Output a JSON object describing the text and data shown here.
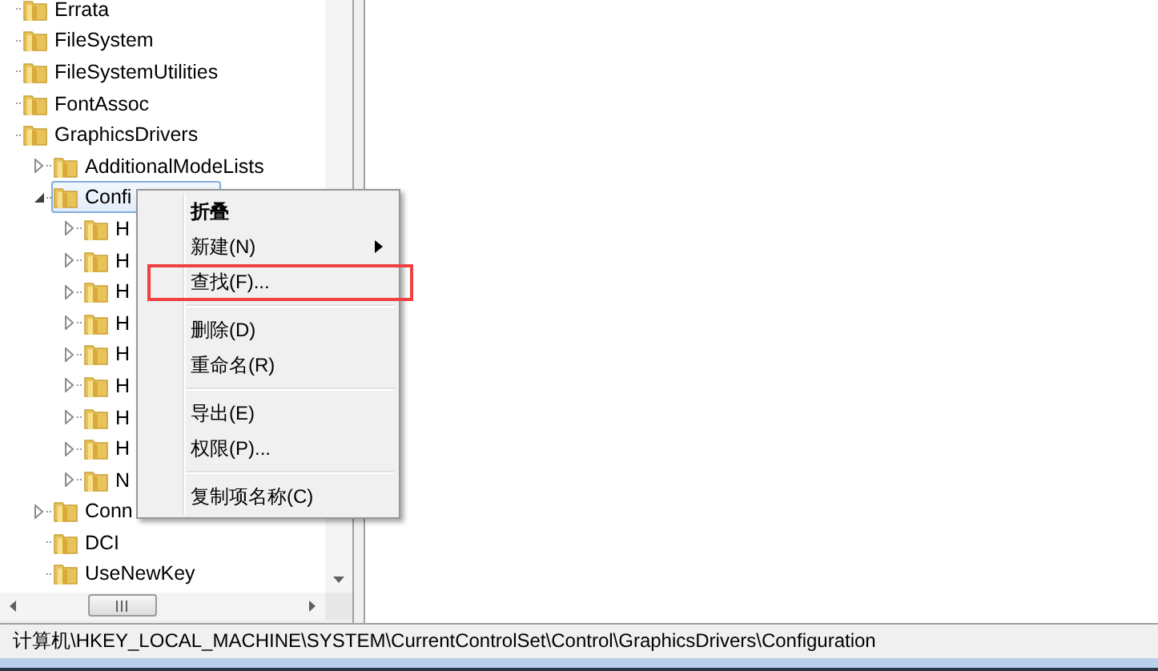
{
  "tree": {
    "items": [
      {
        "label": "Errata",
        "selected": false
      },
      {
        "label": "FileSystem",
        "selected": false
      },
      {
        "label": "FileSystemUtilities",
        "selected": false
      },
      {
        "label": "FontAssoc",
        "selected": false
      },
      {
        "label": "GraphicsDrivers",
        "selected": false,
        "children": [
          {
            "label": "AdditionalModeLists",
            "expanded": false,
            "selected": false
          },
          {
            "label": "Confi",
            "expanded": true,
            "selected": true,
            "children": [
              {
                "label": "H",
                "expanded": false,
                "selected": false
              },
              {
                "label": "H",
                "expanded": false,
                "selected": false
              },
              {
                "label": "H",
                "expanded": false,
                "selected": false
              },
              {
                "label": "H",
                "expanded": false,
                "selected": false
              },
              {
                "label": "H",
                "expanded": false,
                "selected": false
              },
              {
                "label": "H",
                "expanded": false,
                "selected": false
              },
              {
                "label": "H",
                "expanded": false,
                "selected": false
              },
              {
                "label": "H",
                "expanded": false,
                "selected": false
              },
              {
                "label": "N",
                "expanded": false,
                "selected": false
              }
            ]
          },
          {
            "label": "Conn",
            "expanded": false,
            "selected": false
          },
          {
            "label": "DCI",
            "selected": false
          },
          {
            "label": "UseNewKey",
            "selected": false
          }
        ]
      }
    ]
  },
  "menu": {
    "items": [
      {
        "kind": "item",
        "label": "折叠",
        "default": true,
        "submenu": false,
        "highlighted": false
      },
      {
        "kind": "item",
        "label": "新建(N)",
        "default": false,
        "submenu": true,
        "highlighted": false
      },
      {
        "kind": "item",
        "label": "查找(F)...",
        "default": false,
        "submenu": false,
        "highlighted": true
      },
      {
        "kind": "separator"
      },
      {
        "kind": "item",
        "label": "删除(D)",
        "default": false,
        "submenu": false,
        "highlighted": false
      },
      {
        "kind": "item",
        "label": "重命名(R)",
        "default": false,
        "submenu": false,
        "highlighted": false
      },
      {
        "kind": "separator"
      },
      {
        "kind": "item",
        "label": "导出(E)",
        "default": false,
        "submenu": false,
        "highlighted": false
      },
      {
        "kind": "item",
        "label": "权限(P)...",
        "default": false,
        "submenu": false,
        "highlighted": false
      },
      {
        "kind": "separator"
      },
      {
        "kind": "item",
        "label": "复制项名称(C)",
        "default": false,
        "submenu": false,
        "highlighted": false
      }
    ]
  },
  "status_bar": {
    "path": "计算机\\HKEY_LOCAL_MACHINE\\SYSTEM\\CurrentControlSet\\Control\\GraphicsDrivers\\Configuration"
  }
}
